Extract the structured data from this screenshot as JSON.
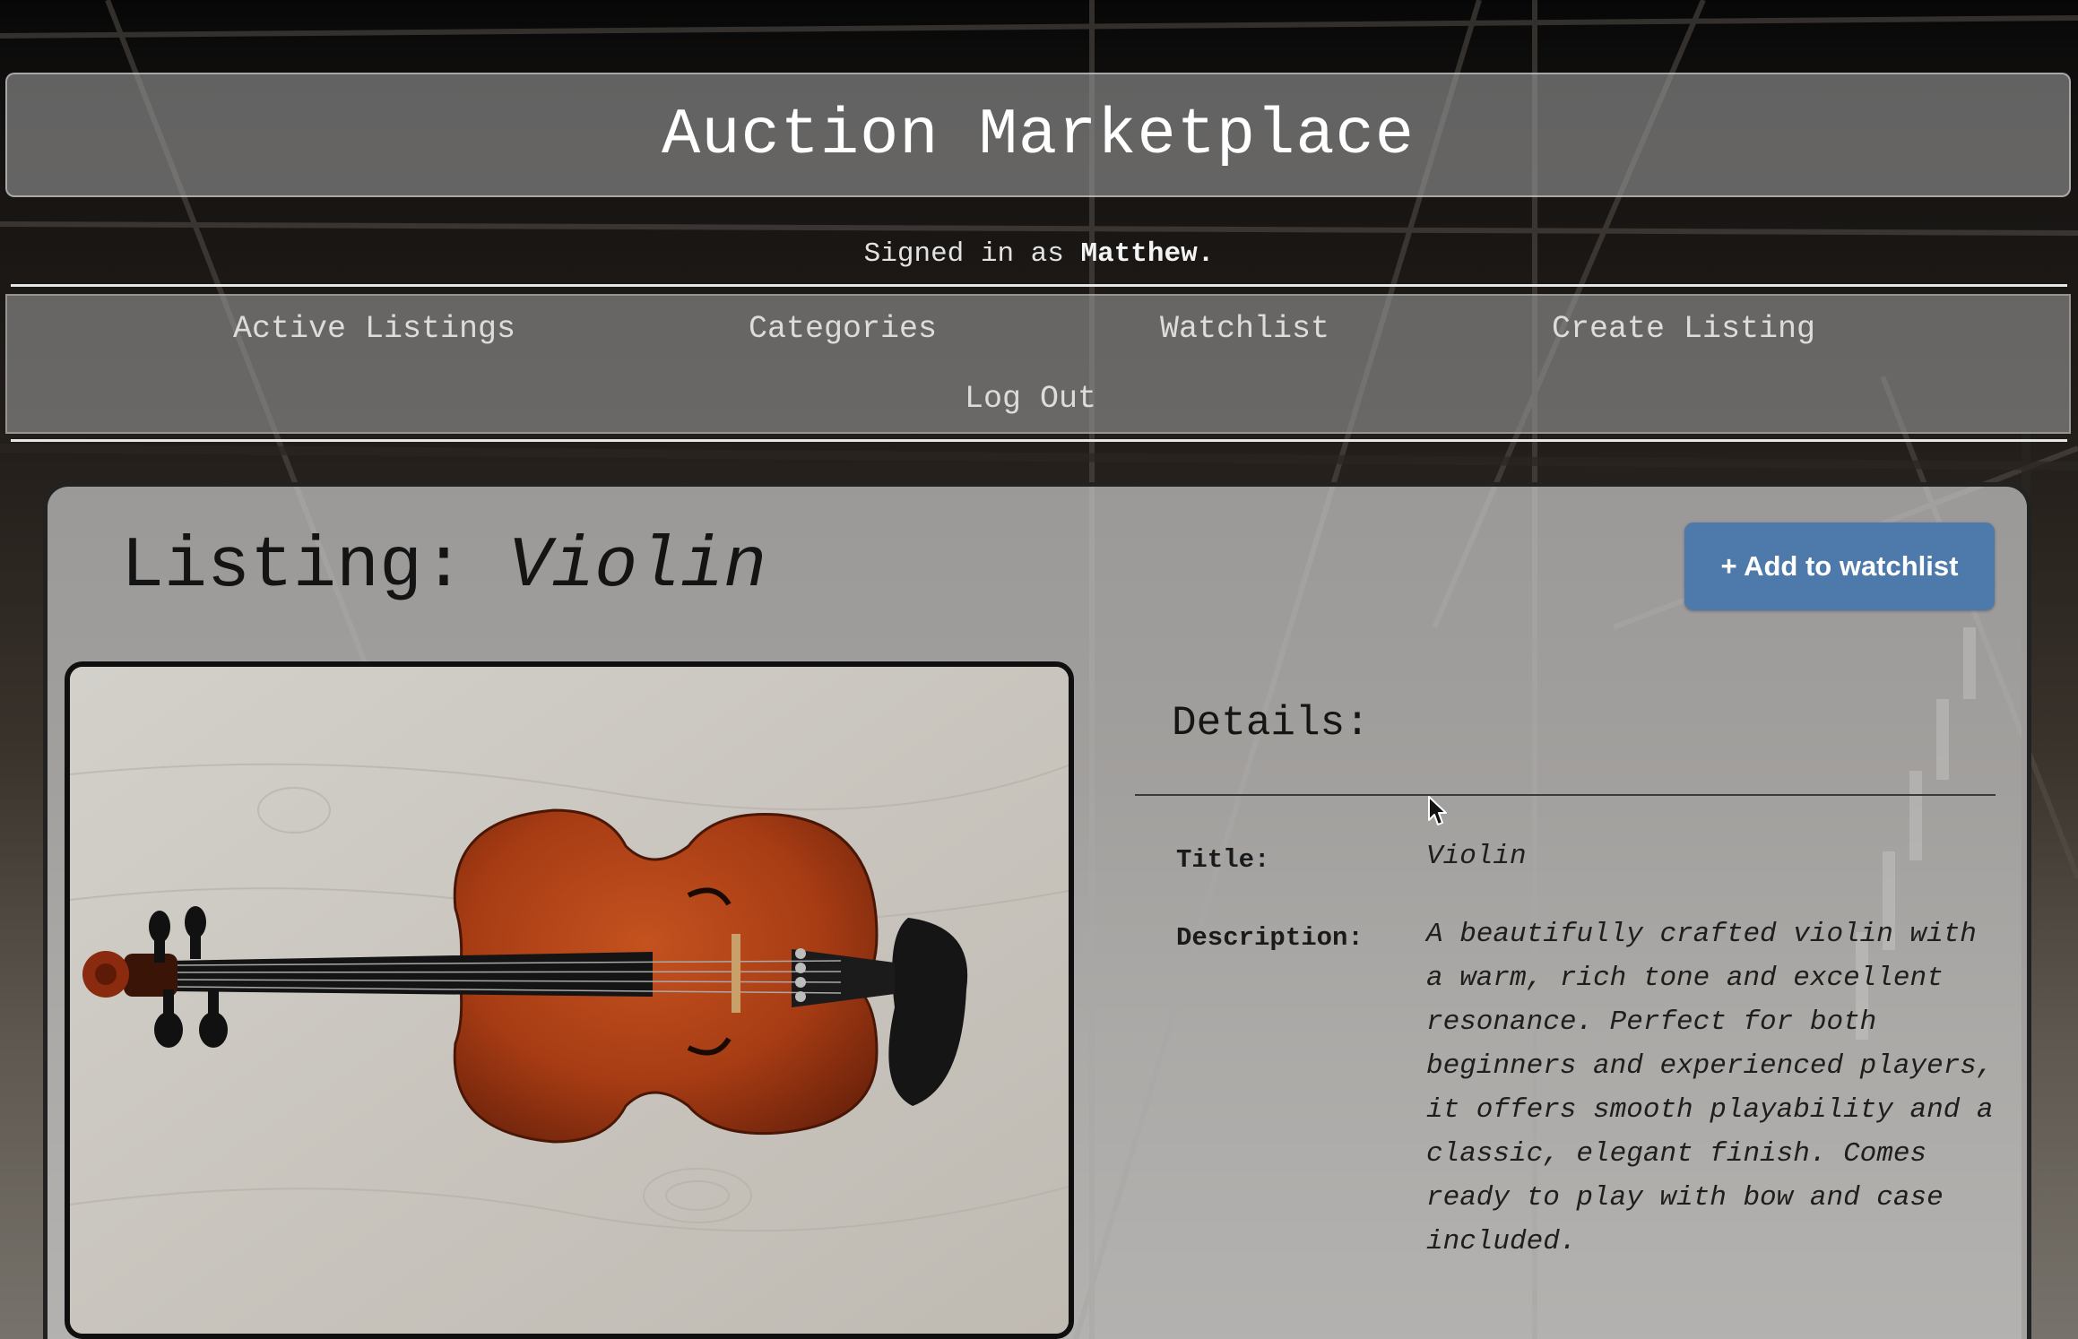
{
  "site": {
    "title": "Auction Marketplace",
    "signed_in_prefix": "Signed in as ",
    "username": "Matthew."
  },
  "nav": {
    "items": [
      {
        "label": "Active Listings"
      },
      {
        "label": "Categories"
      },
      {
        "label": "Watchlist"
      },
      {
        "label": "Create Listing"
      },
      {
        "label": "Log Out"
      }
    ]
  },
  "listing": {
    "heading_prefix": "Listing: ",
    "title": "Violin",
    "watchlist_button": "+ Add to watchlist",
    "image_icon": "violin-photo",
    "details_heading": "Details:",
    "title_label": "Title:",
    "title_value": "Violin",
    "description_label": "Description:",
    "description_value": "A beautifully crafted violin with a warm, rich tone and excellent resonance. Perfect for both beginners and experienced players, it offers smooth playability and a classic, elegant finish. Comes ready to play with bow and case included."
  },
  "colors": {
    "button": "#4e7aab",
    "panel": "#969696",
    "card": "#cdcdcd"
  }
}
